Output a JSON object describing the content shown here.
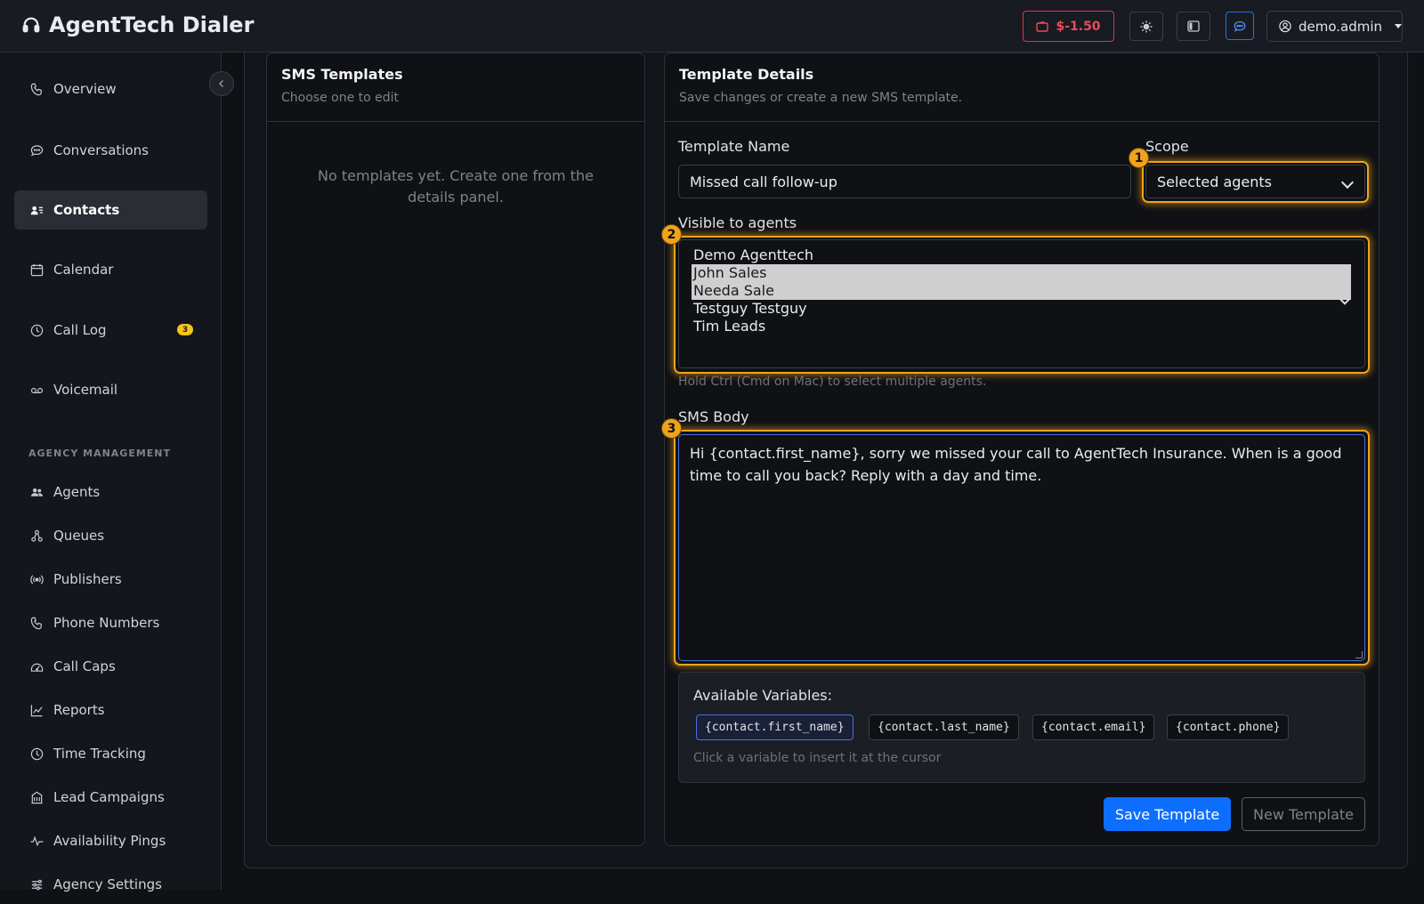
{
  "app": {
    "title": "AgentTech Dialer"
  },
  "header": {
    "balance": "$-1.50",
    "user": "demo.admin"
  },
  "sidebar": {
    "items": [
      {
        "label": "Overview",
        "icon": "phone-icon"
      },
      {
        "label": "Conversations",
        "icon": "chat-icon"
      },
      {
        "label": "Contacts",
        "icon": "contacts-icon",
        "active": true
      },
      {
        "label": "Calendar",
        "icon": "calendar-icon"
      },
      {
        "label": "Call Log",
        "icon": "clock-icon",
        "badge": "3"
      },
      {
        "label": "Voicemail",
        "icon": "voicemail-icon"
      }
    ],
    "section_label": "AGENCY MANAGEMENT",
    "management_items": [
      {
        "label": "Agents",
        "icon": "people-icon"
      },
      {
        "label": "Queues",
        "icon": "queue-icon"
      },
      {
        "label": "Publishers",
        "icon": "broadcast-icon"
      },
      {
        "label": "Phone Numbers",
        "icon": "phone-icon"
      },
      {
        "label": "Call Caps",
        "icon": "gauge-icon"
      },
      {
        "label": "Reports",
        "icon": "chart-icon"
      },
      {
        "label": "Time Tracking",
        "icon": "clock-icon"
      },
      {
        "label": "Lead Campaigns",
        "icon": "building-icon"
      },
      {
        "label": "Availability Pings",
        "icon": "pulse-icon"
      },
      {
        "label": "Agency Settings",
        "icon": "settings-icon"
      }
    ]
  },
  "templates_panel": {
    "title": "SMS Templates",
    "subtitle": "Choose one to edit",
    "empty_message": "No templates yet. Create one from the details panel."
  },
  "details_panel": {
    "title": "Template Details",
    "subtitle": "Save changes or create a new SMS template.",
    "name_label": "Template Name",
    "name_value": "Missed call follow-up",
    "scope_label": "Scope",
    "scope_value": "Selected agents",
    "agents_label": "Visible to agents",
    "agents": [
      {
        "name": "Demo Agenttech",
        "selected": false
      },
      {
        "name": "John Sales",
        "selected": true
      },
      {
        "name": "Needa Sale",
        "selected": true
      },
      {
        "name": "Testguy Testguy",
        "selected": false
      },
      {
        "name": "Tim Leads",
        "selected": false
      }
    ],
    "agents_hint": "Hold Ctrl (Cmd on Mac) to select multiple agents.",
    "body_label": "SMS Body",
    "body_value": "Hi {contact.first_name}, sorry we missed your call to AgentTech Insurance. When is a good time to call you back? Reply with a day and time.",
    "variables_title": "Available Variables:",
    "variables": [
      "{contact.first_name}",
      "{contact.last_name}",
      "{contact.email}",
      "{contact.phone}"
    ],
    "variables_hint": "Click a variable to insert it at the cursor",
    "save_label": "Save Template",
    "new_label": "New Template"
  },
  "markers": [
    "1",
    "2",
    "3"
  ],
  "colors": {
    "accent": "#0d6efd",
    "highlight": "#f0a31a",
    "danger": "#dc3545",
    "badge": "#f5c518"
  }
}
